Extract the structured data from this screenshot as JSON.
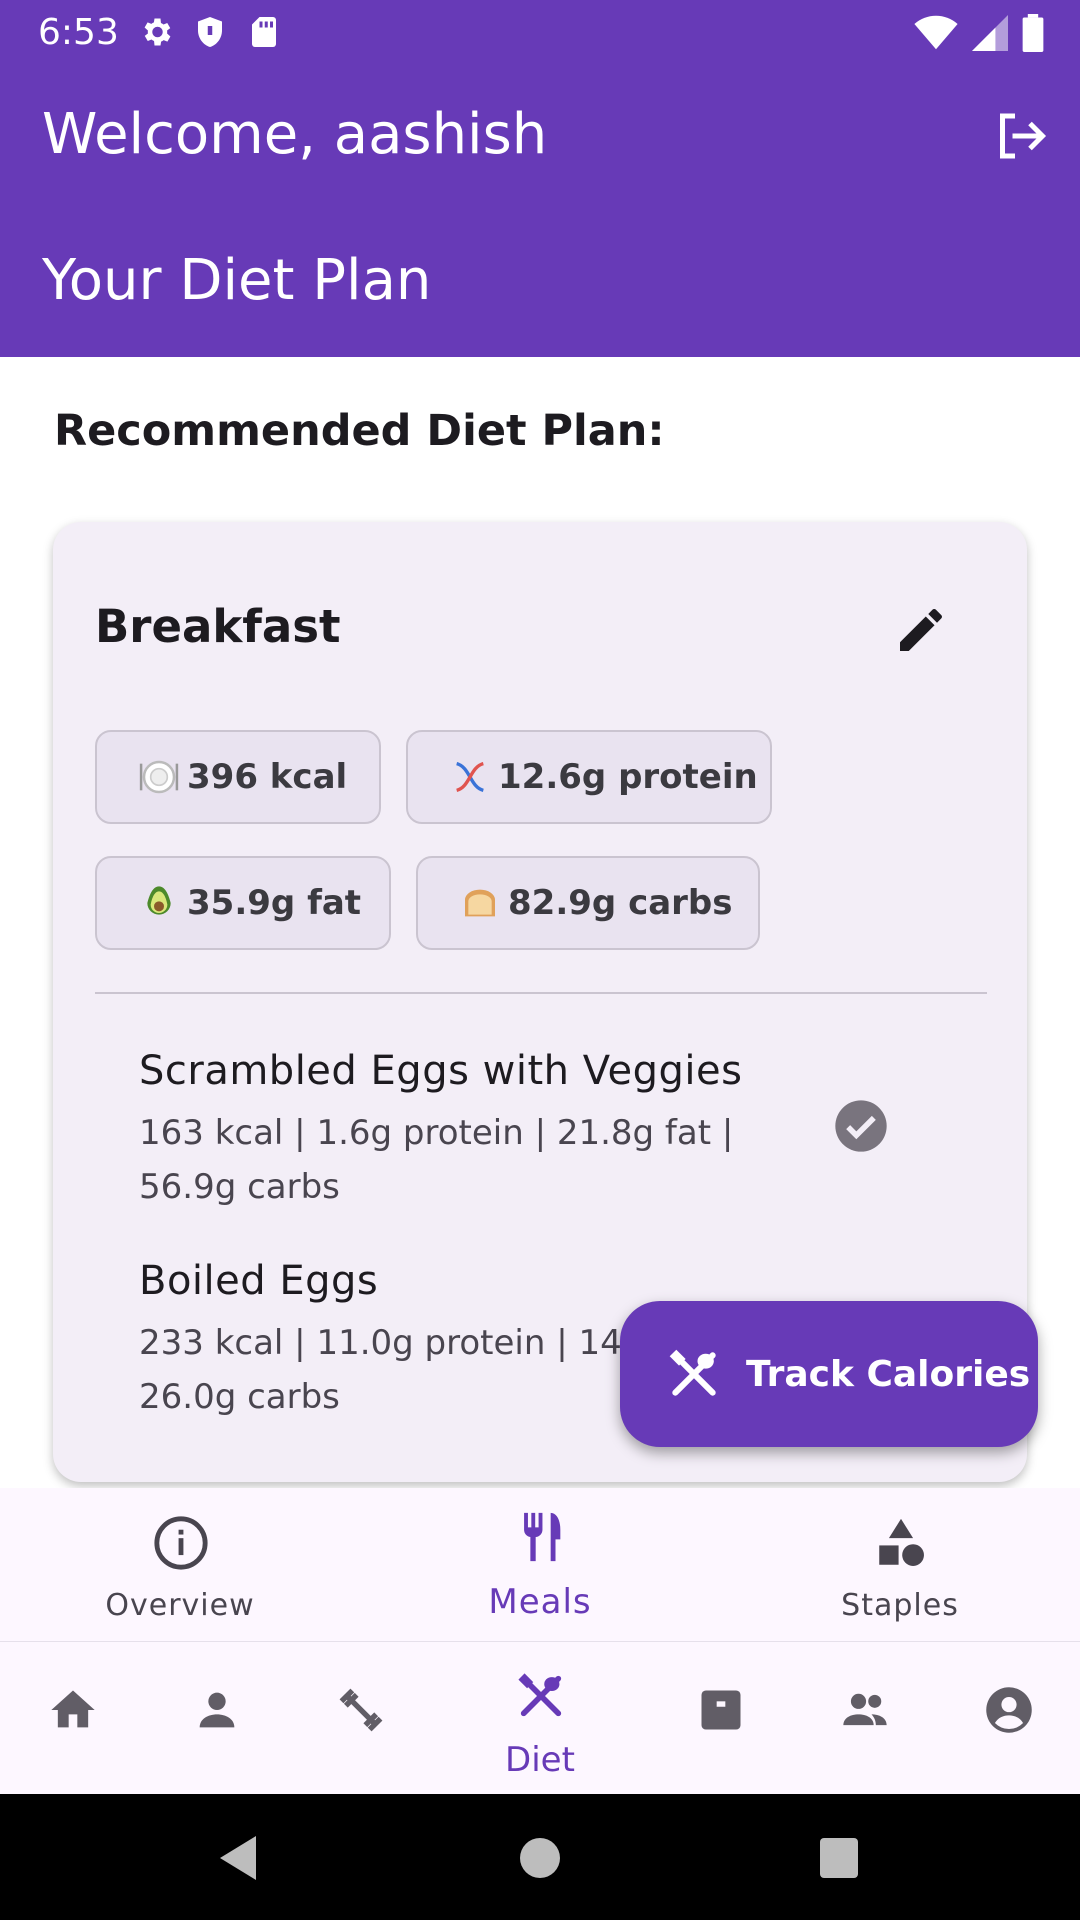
{
  "status_bar": {
    "time": "6:53",
    "icons": [
      "settings-icon",
      "shield-icon",
      "sd-card-icon"
    ],
    "right_icons": [
      "wifi-icon",
      "signal-icon",
      "battery-icon"
    ]
  },
  "header": {
    "welcome": "Welcome, aashish",
    "subtitle": "Your Diet Plan",
    "logout_icon": "logout-icon",
    "color": "#673ab7"
  },
  "main": {
    "section_title": "Recommended Diet Plan:",
    "meal": {
      "title": "Breakfast",
      "edit_icon": "edit-pencil-icon",
      "chips": [
        {
          "icon": "plate-emoji",
          "label": "396 kcal"
        },
        {
          "icon": "dna-emoji",
          "label": "12.6g protein"
        },
        {
          "icon": "avocado-emoji",
          "label": "35.9g fat"
        },
        {
          "icon": "bread-emoji",
          "label": "82.9g carbs"
        }
      ],
      "items": [
        {
          "name": "Scrambled Eggs with Veggies",
          "detail": "163 kcal | 1.6g protein | 21.8g fat | 56.9g carbs",
          "status_icon": "check-circle-icon"
        },
        {
          "name": "Boiled Eggs",
          "detail": "233 kcal | 11.0g protein | 14.1g fat | 26.0g carbs"
        }
      ]
    }
  },
  "fab": {
    "label": "Track Calories",
    "icon": "utensils-cross-icon"
  },
  "tabs": [
    {
      "label": "Overview",
      "icon": "info-icon",
      "active": false
    },
    {
      "label": "Meals",
      "icon": "fork-knife-icon",
      "active": true
    },
    {
      "label": "Staples",
      "icon": "shapes-icon",
      "active": false
    }
  ],
  "bottom_nav": {
    "items": [
      {
        "icon": "home-icon"
      },
      {
        "icon": "person-icon"
      },
      {
        "icon": "dumbbell-icon"
      },
      {
        "icon": "utensils-cross-icon",
        "label": "Diet",
        "active": true
      },
      {
        "icon": "chat-icon"
      },
      {
        "icon": "group-icon"
      },
      {
        "icon": "account-circle-icon"
      }
    ]
  },
  "system_nav": [
    "back-icon",
    "home-circle-icon",
    "recents-icon"
  ]
}
